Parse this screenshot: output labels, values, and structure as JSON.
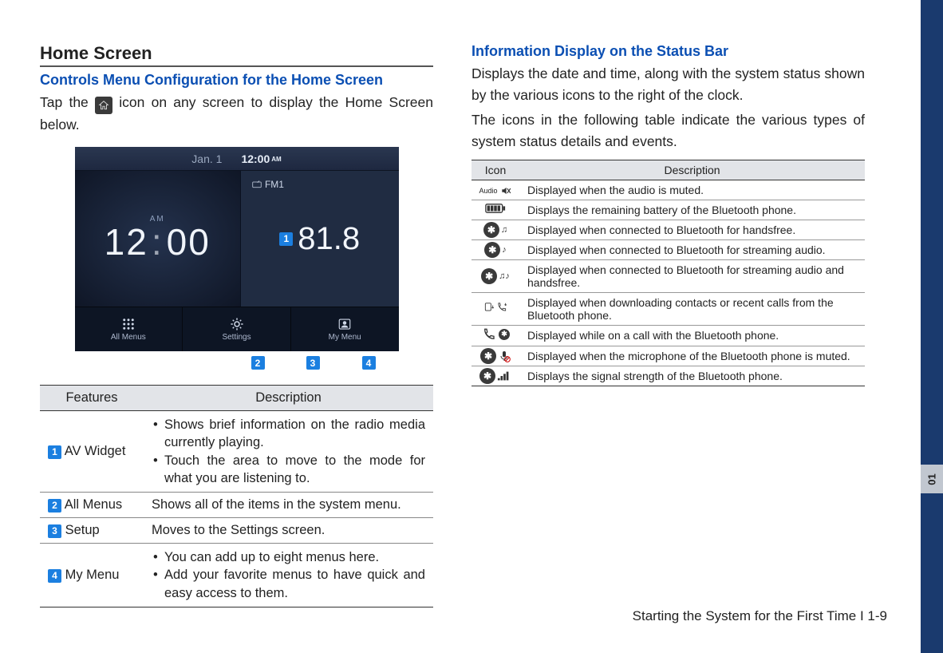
{
  "left": {
    "section_title": "Home Screen",
    "subtitle": "Controls Menu Configuration for the Home Screen",
    "intro_before": "Tap the ",
    "intro_after": " icon on any screen to display the Home Screen below.",
    "shot": {
      "date": "Jan.  1",
      "time": "12:00",
      "time_suffix": "AM",
      "clock_ampm": "AM",
      "clock_hour": "12",
      "clock_min": "00",
      "fm_label": "FM1",
      "freq": "81.8",
      "bottom": [
        "All Menus",
        "Settings",
        "My Menu"
      ]
    },
    "features_header": [
      "Features",
      "Description"
    ],
    "features": [
      {
        "badge": "1",
        "name": "AV Widget",
        "bullets": [
          "Shows brief information on the radio media currently playing.",
          "Touch the area to move to the mode for what you are listening to."
        ]
      },
      {
        "badge": "2",
        "name": "All Menus",
        "desc": "Shows all of the items in the system menu."
      },
      {
        "badge": "3",
        "name": "Setup",
        "desc": "Moves to the Settings screen."
      },
      {
        "badge": "4",
        "name": "My Menu",
        "bullets": [
          "You can add up to eight menus here.",
          "Add your favorite menus to have quick and easy access to them."
        ]
      }
    ]
  },
  "right": {
    "title": "Information Display on the Status Bar",
    "para1": "Displays the date and time, along with the system status shown by the various icons to the right of the clock.",
    "para2": "The icons in the following table indicate the various types of system status details and events.",
    "icons_header": [
      "Icon",
      "Description"
    ],
    "rows": [
      "Displayed when the audio is muted.",
      "Displays the remaining battery of the Bluetooth phone.",
      "Displayed when connected to Bluetooth for handsfree.",
      "Displayed when connected to Bluetooth for streaming audio.",
      "Displayed when connected to Bluetooth for streaming audio and handsfree.",
      "Displayed when downloading contacts or recent calls from the Bluetooth phone.",
      "Displayed while on a call with the Bluetooth phone.",
      "Displayed when the microphone of the Bluetooth phone is muted.",
      "Displays the signal strength of the Bluetooth phone."
    ]
  },
  "footer": "Starting the System for the First Time I 1-9",
  "chapter_tab": "01"
}
